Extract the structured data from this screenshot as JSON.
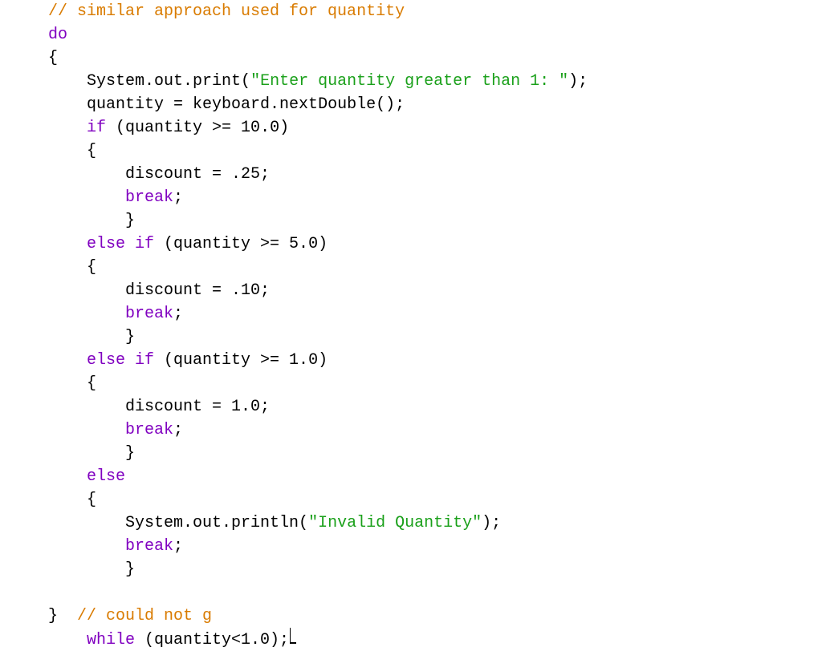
{
  "code": {
    "lines": [
      {
        "indent": 0,
        "parts": [
          {
            "cls": "com",
            "t": "// similar approach used for quantity"
          }
        ]
      },
      {
        "indent": 0,
        "parts": [
          {
            "cls": "kw",
            "t": "do"
          }
        ]
      },
      {
        "indent": 0,
        "parts": [
          {
            "cls": "plain",
            "t": "{"
          }
        ]
      },
      {
        "indent": 1,
        "parts": [
          {
            "cls": "plain",
            "t": "System.out.print("
          },
          {
            "cls": "str",
            "t": "\"Enter quantity greater than 1: \""
          },
          {
            "cls": "plain",
            "t": ");"
          }
        ]
      },
      {
        "indent": 1,
        "parts": [
          {
            "cls": "plain",
            "t": "quantity = keyboard.nextDouble();"
          }
        ]
      },
      {
        "indent": 1,
        "parts": [
          {
            "cls": "kw",
            "t": "if"
          },
          {
            "cls": "plain",
            "t": " (quantity >= 10.0)"
          }
        ]
      },
      {
        "indent": 1,
        "parts": [
          {
            "cls": "plain",
            "t": "{"
          }
        ]
      },
      {
        "indent": 2,
        "parts": [
          {
            "cls": "plain",
            "t": "discount = .25;"
          }
        ]
      },
      {
        "indent": 2,
        "parts": [
          {
            "cls": "kw",
            "t": "break"
          },
          {
            "cls": "plain",
            "t": ";"
          }
        ]
      },
      {
        "indent": 2,
        "parts": [
          {
            "cls": "plain",
            "t": "}"
          }
        ]
      },
      {
        "indent": 1,
        "parts": [
          {
            "cls": "kw",
            "t": "else if"
          },
          {
            "cls": "plain",
            "t": " (quantity >= 5.0)"
          }
        ]
      },
      {
        "indent": 1,
        "parts": [
          {
            "cls": "plain",
            "t": "{"
          }
        ]
      },
      {
        "indent": 2,
        "parts": [
          {
            "cls": "plain",
            "t": "discount = .10;"
          }
        ]
      },
      {
        "indent": 2,
        "parts": [
          {
            "cls": "kw",
            "t": "break"
          },
          {
            "cls": "plain",
            "t": ";"
          }
        ]
      },
      {
        "indent": 2,
        "parts": [
          {
            "cls": "plain",
            "t": "}"
          }
        ]
      },
      {
        "indent": 1,
        "parts": [
          {
            "cls": "kw",
            "t": "else if"
          },
          {
            "cls": "plain",
            "t": " (quantity >= 1.0)"
          }
        ]
      },
      {
        "indent": 1,
        "parts": [
          {
            "cls": "plain",
            "t": "{"
          }
        ]
      },
      {
        "indent": 2,
        "parts": [
          {
            "cls": "plain",
            "t": "discount = 1.0;"
          }
        ]
      },
      {
        "indent": 2,
        "parts": [
          {
            "cls": "kw",
            "t": "break"
          },
          {
            "cls": "plain",
            "t": ";"
          }
        ]
      },
      {
        "indent": 2,
        "parts": [
          {
            "cls": "plain",
            "t": "}"
          }
        ]
      },
      {
        "indent": 1,
        "parts": [
          {
            "cls": "kw",
            "t": "else"
          }
        ]
      },
      {
        "indent": 1,
        "parts": [
          {
            "cls": "plain",
            "t": "{"
          }
        ]
      },
      {
        "indent": 2,
        "parts": [
          {
            "cls": "plain",
            "t": "System.out.println("
          },
          {
            "cls": "str",
            "t": "\"Invalid Quantity\""
          },
          {
            "cls": "plain",
            "t": ");"
          }
        ]
      },
      {
        "indent": 2,
        "parts": [
          {
            "cls": "kw",
            "t": "break"
          },
          {
            "cls": "plain",
            "t": ";"
          }
        ]
      },
      {
        "indent": 2,
        "parts": [
          {
            "cls": "plain",
            "t": "}"
          }
        ]
      },
      {
        "indent": 0,
        "parts": [
          {
            "cls": "plain",
            "t": ""
          }
        ]
      },
      {
        "indent": 0,
        "parts": [
          {
            "cls": "plain",
            "t": "}  "
          },
          {
            "cls": "com",
            "t": "// could not g"
          }
        ]
      },
      {
        "indent": 1,
        "parts": [
          {
            "cls": "kw",
            "t": "while"
          },
          {
            "cls": "plain",
            "t": " (quantity<1.0);"
          }
        ],
        "cursor": true
      }
    ],
    "indentUnit": "    "
  }
}
